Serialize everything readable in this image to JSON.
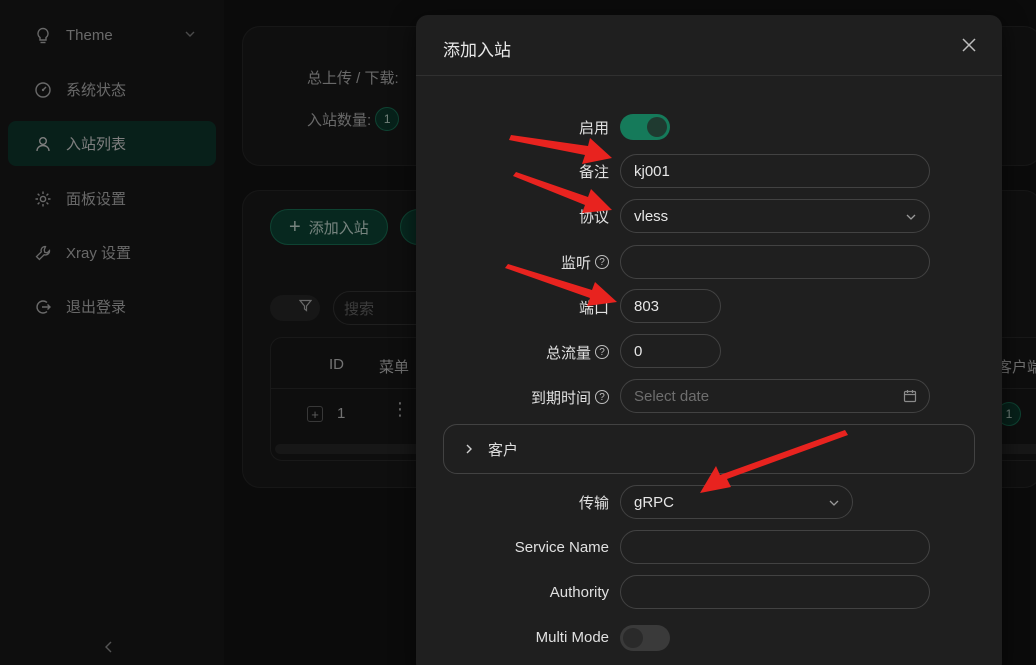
{
  "sidebar": {
    "items": [
      {
        "label": "Theme",
        "icon": "lightbulb-icon"
      },
      {
        "label": "系统状态",
        "icon": "dashboard-icon"
      },
      {
        "label": "入站列表",
        "icon": "user-icon",
        "active": true
      },
      {
        "label": "面板设置",
        "icon": "gear-icon"
      },
      {
        "label": "Xray 设置",
        "icon": "wrench-icon"
      },
      {
        "label": "退出登录",
        "icon": "logout-icon"
      }
    ]
  },
  "stats": {
    "traffic_label": "总上传 / 下载:",
    "count_label": "入站数量:",
    "count_value": "1"
  },
  "inbound_list": {
    "add_button": "添加入站",
    "search_placeholder": "搜索",
    "columns": [
      "ID",
      "菜单",
      "客户端"
    ],
    "rows": [
      {
        "id": "1",
        "client_count": "1"
      }
    ]
  },
  "modal": {
    "title": "添加入站",
    "enable_label": "启用",
    "enable_on": true,
    "remark_label": "备注",
    "remark_value": "kj001",
    "protocol_label": "协议",
    "protocol_value": "vless",
    "listen_label": "监听",
    "listen_value": "",
    "port_label": "端口",
    "port_value": "803",
    "total_traffic_label": "总流量",
    "total_traffic_value": "0",
    "expiry_label": "到期时间",
    "expiry_placeholder": "Select date",
    "clients_panel_label": "客户",
    "transport_label": "传输",
    "transport_value": "gRPC",
    "service_name_label": "Service Name",
    "service_name_value": "",
    "authority_label": "Authority",
    "authority_value": "",
    "multi_mode_label": "Multi Mode",
    "multi_mode_on": false
  },
  "colors": {
    "accent": "#157a5a",
    "annotation_arrow": "#e8231f"
  }
}
